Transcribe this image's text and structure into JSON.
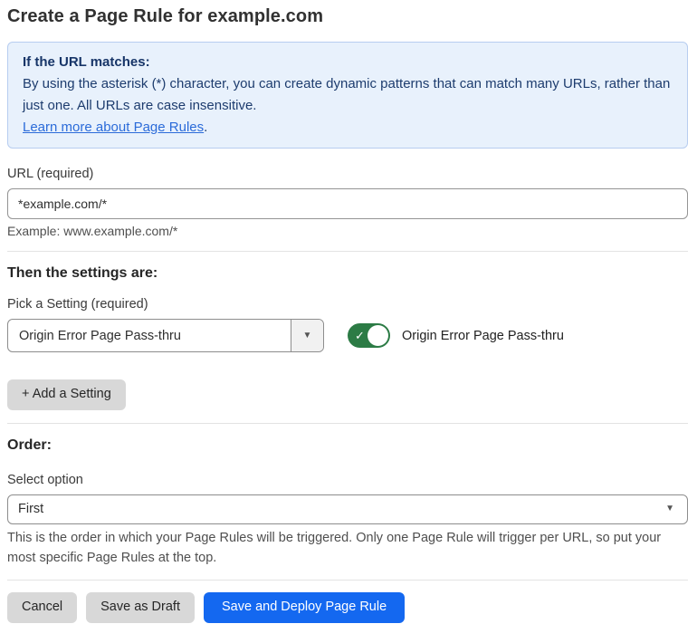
{
  "page": {
    "title": "Create a Page Rule for example.com"
  },
  "info_box": {
    "heading": "If the URL matches:",
    "body": "By using the asterisk (*) character, you can create dynamic patterns that can match many URLs, rather than just one. All URLs are case insensitive.",
    "link_label": "Learn more about Page Rules",
    "link_suffix": "."
  },
  "url_field": {
    "label": "URL (required)",
    "value": "*example.com/*",
    "helper": "Example: www.example.com/*"
  },
  "settings_section": {
    "heading": "Then the settings are:",
    "picker_label": "Pick a Setting (required)",
    "picker_value": "Origin Error Page Pass-thru",
    "toggle_state": "on",
    "toggle_label": "Origin Error Page Pass-thru",
    "add_setting_label": "+ Add a Setting"
  },
  "order_section": {
    "heading": "Order:",
    "select_label": "Select option",
    "select_value": "First",
    "helper": "This is the order in which your Page Rules will be triggered. Only one Page Rule will trigger per URL, so put your most specific Page Rules at the top."
  },
  "actions": {
    "cancel_label": "Cancel",
    "save_draft_label": "Save as Draft",
    "save_deploy_label": "Save and Deploy Page Rule"
  },
  "icons": {
    "dropdown_arrow": "▼",
    "toggle_check": "✓"
  },
  "colors": {
    "accent_blue": "#1468f0",
    "toggle_green": "#2c7b45",
    "info_bg": "#e8f1fc",
    "info_border": "#b7cdf0",
    "info_text": "#1d3c6e",
    "link_blue": "#2b6bd9"
  }
}
